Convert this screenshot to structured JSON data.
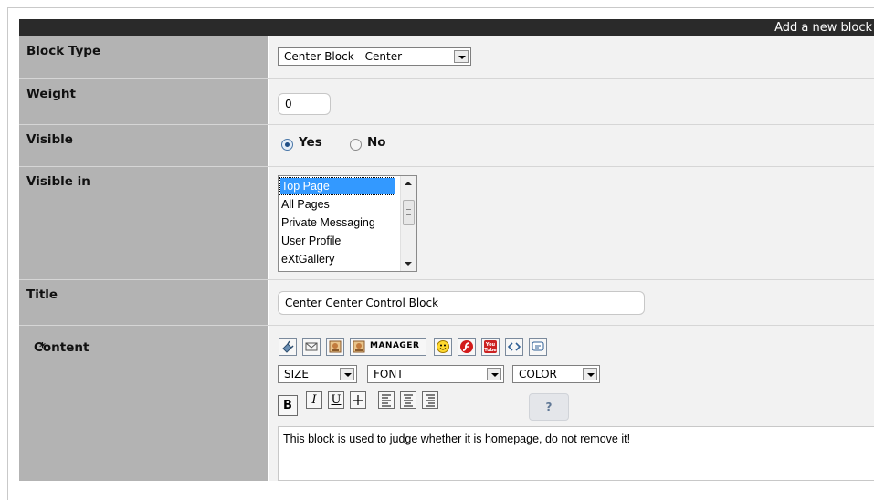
{
  "header": {
    "title": "Add a new block"
  },
  "fields": {
    "block_type": {
      "label": "Block Type",
      "selected": "Center Block - Center"
    },
    "weight": {
      "label": "Weight",
      "value": "0"
    },
    "visible": {
      "label": "Visible",
      "options": [
        "Yes",
        "No"
      ],
      "selected": "Yes"
    },
    "visible_in": {
      "label": "Visible in",
      "options": [
        "Top Page",
        "All Pages",
        "Private Messaging",
        "User Profile",
        "eXtGallery"
      ],
      "selected": "Top Page"
    },
    "title": {
      "label": "Title",
      "value": "Center Center Control Block"
    },
    "content": {
      "label": "Content",
      "required_mark": "*",
      "toolbar": {
        "icons": [
          "url-icon",
          "email-icon",
          "image-icon",
          "image-manager-icon",
          "smiley-icon",
          "flash-icon",
          "youtube-icon",
          "code-icon",
          "quote-icon"
        ],
        "manager_label": "MANAGER",
        "youtube_label": "You\nTube",
        "size_label": "SIZE",
        "font_label": "FONT",
        "color_label": "COLOR",
        "bold": "B",
        "italic": "I",
        "underline": "U",
        "strike": "—",
        "help": "?"
      },
      "value": "This block is used to judge whether it is homepage, do not remove it!"
    }
  },
  "colors": {
    "label_bg": "#b3b3b3",
    "value_bg": "#f2f2f2",
    "header_bg": "#2a2a2a",
    "required": "#ff2a2a",
    "selection": "#3399ff"
  }
}
